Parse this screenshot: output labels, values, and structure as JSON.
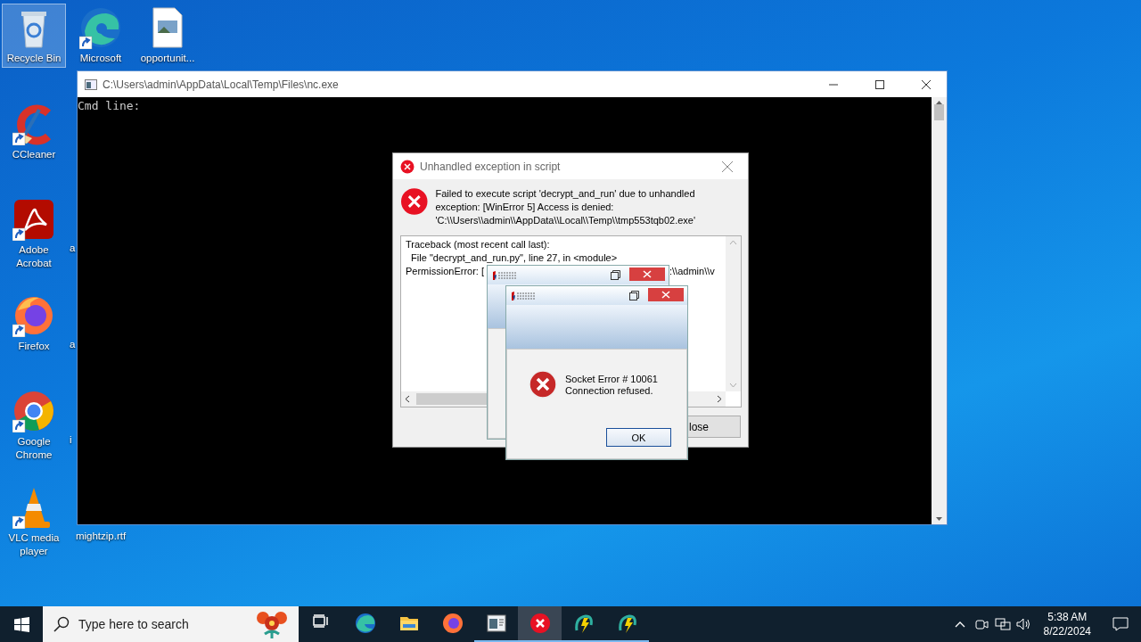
{
  "desktop_icons": [
    {
      "label": "Recycle Bin",
      "kind": "recycle",
      "shortcut": false,
      "selected": true
    },
    {
      "label": "CCleaner",
      "kind": "ccleaner",
      "shortcut": true,
      "selected": false
    },
    {
      "label": "Adobe Acrobat",
      "kind": "acrobat",
      "shortcut": true,
      "selected": false
    },
    {
      "label": "Firefox",
      "kind": "firefox",
      "shortcut": true,
      "selected": false
    },
    {
      "label": "Google Chrome",
      "kind": "chrome",
      "shortcut": true,
      "selected": false
    },
    {
      "label": "VLC media player",
      "kind": "vlc",
      "shortcut": true,
      "selected": false
    },
    {
      "label": "Microsoft",
      "kind": "edge",
      "shortcut": true,
      "selected": false
    },
    {
      "label": "a",
      "kind": "none",
      "shortcut": false,
      "selected": false
    },
    {
      "label": "a",
      "kind": "none",
      "shortcut": false,
      "selected": false
    },
    {
      "label": "i",
      "kind": "none",
      "shortcut": false,
      "selected": false
    },
    {
      "label": "mightzip.rtf",
      "kind": "none",
      "shortcut": false,
      "selected": false
    },
    {
      "label": "opportunit...",
      "kind": "image-file",
      "shortcut": false,
      "selected": false
    }
  ],
  "console_window": {
    "title": "C:\\Users\\admin\\AppData\\Local\\Temp\\Files\\nc.exe",
    "text": "Cmd line:"
  },
  "error_dialog": {
    "title": "Unhandled exception in script",
    "message": "Failed to execute script 'decrypt_and_run' due to unhandled exception: [WinError 5] Access is denied: 'C:\\\\Users\\\\admin\\\\AppData\\\\Local\\\\Temp\\\\tmp553tqb02.exe'",
    "traceback": [
      "Traceback (most recent call last):",
      "  File \"decrypt_and_run.py\", line 27, in <module>",
      "PermissionError: ["
    ],
    "traceback_tail": ":\\\\admin\\\\v",
    "button": "lose"
  },
  "socket_dialog": {
    "message": "Socket Error # 10061\nConnection refused.",
    "button": "OK"
  },
  "taskbar": {
    "search": {
      "placeholder": "Type here to search"
    },
    "apps": [
      {
        "kind": "taskview",
        "running": false,
        "selected": false
      },
      {
        "kind": "edge",
        "running": false,
        "selected": false
      },
      {
        "kind": "folder",
        "running": false,
        "selected": false
      },
      {
        "kind": "firefox",
        "running": false,
        "selected": false
      },
      {
        "kind": "console",
        "running": true,
        "selected": false
      },
      {
        "kind": "error",
        "running": true,
        "selected": true
      },
      {
        "kind": "app",
        "running": true,
        "selected": false
      },
      {
        "kind": "app",
        "running": true,
        "selected": false
      }
    ],
    "time": "5:38 AM",
    "date": "8/22/2024"
  }
}
